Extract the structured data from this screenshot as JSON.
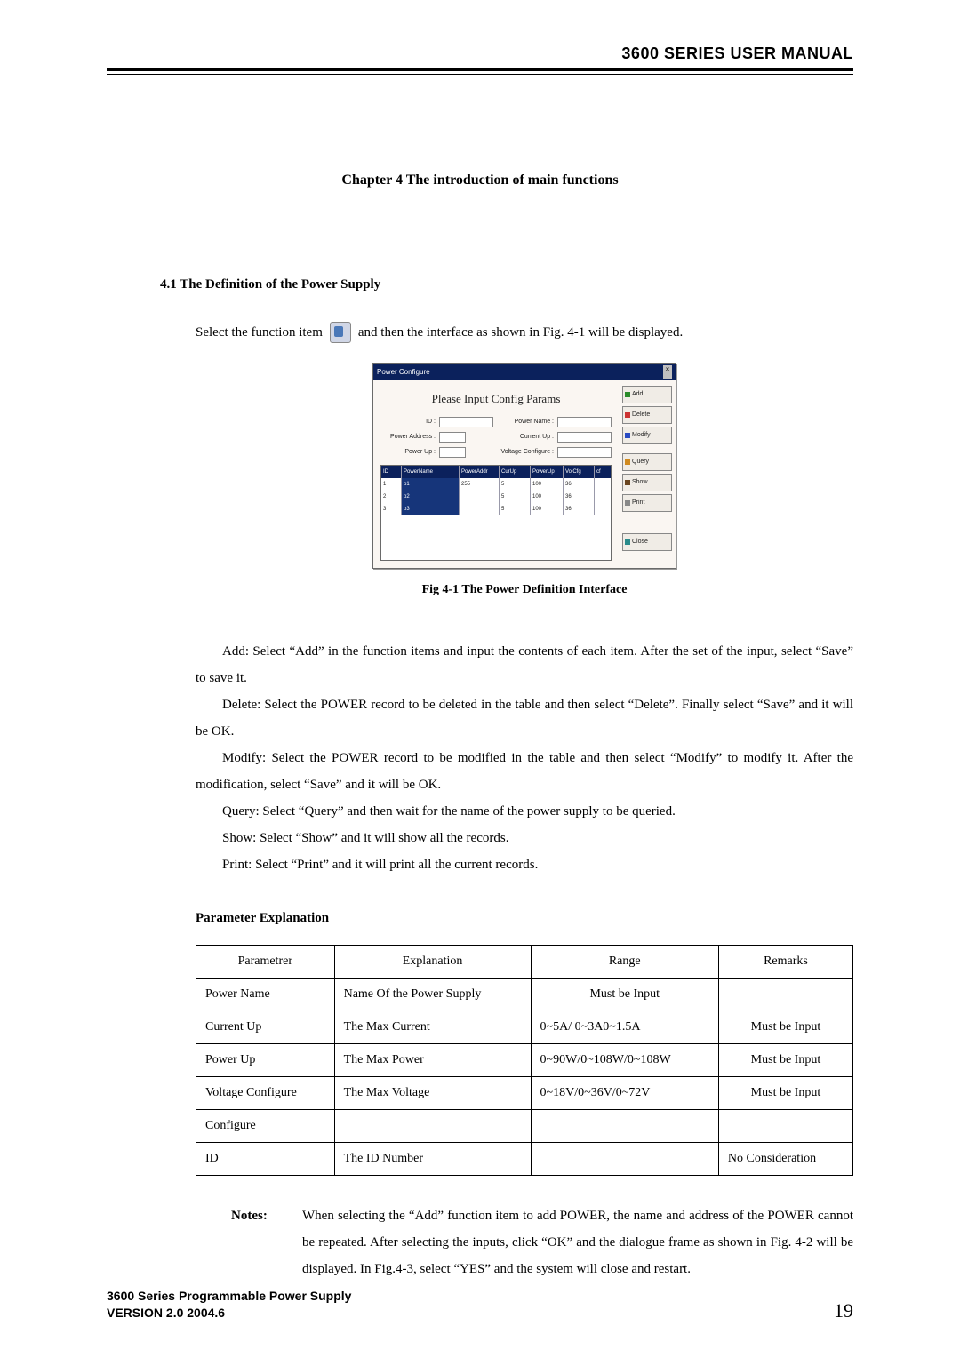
{
  "header": {
    "title": "3600 SERIES USER MANUAL"
  },
  "chapter": "Chapter 4    The introduction of main functions",
  "section": "4.1 The Definition of the Power Supply",
  "select_line": {
    "before": "Select the function item",
    "after": "and then the interface as shown in Fig. 4-1 will be displayed."
  },
  "dialog": {
    "titlebar": "Power Configure",
    "heading": "Please Input Config Params",
    "labels": {
      "id": "ID :",
      "power_name": "Power Name :",
      "power_address": "Power Address :",
      "current_up": "Current Up :",
      "power_up": "Power Up :",
      "voltage_configure": "Voltage Configure :"
    },
    "columns": [
      "ID",
      "PowerName",
      "PowerAddr",
      "CurUp",
      "PowerUp",
      "VolCfg",
      "cf"
    ],
    "rows": [
      {
        "id": "1",
        "name": "p1",
        "pa": "255",
        "cu": "5",
        "pu": "100",
        "vc": "36",
        "cf": ""
      },
      {
        "id": "2",
        "name": "p2",
        "pa": "",
        "cu": "5",
        "pu": "100",
        "vc": "36",
        "cf": ""
      },
      {
        "id": "3",
        "name": "p3",
        "pa": "",
        "cu": "5",
        "pu": "100",
        "vc": "36",
        "cf": ""
      }
    ],
    "buttons": {
      "add": "Add",
      "delete": "Delete",
      "modify": "Modify",
      "query": "Query",
      "show": "Show",
      "print": "Print",
      "close": "Close"
    }
  },
  "fig_caption": "Fig 4-1 The Power Definition Interface",
  "paragraphs": {
    "add": "Add:  Select “Add” in the function items and input the contents of each item. After the set  of the input, select “Save” to save it.",
    "delete": "Delete: Select the POWER record to be deleted in the table and then select “Delete”. Finally select “Save” and it will be OK.",
    "modify": "Modify: Select the POWER record to be modified in the table and then select “Modify” to modify it. After the modification, select “Save” and it will be OK.",
    "query": "Query:  Select “Query” and then wait for the name of the power supply to be queried.",
    "show": "Show:  Select “Show” and it will show all the records.",
    "print": "Print:   Select “Print” and it will print all the current records."
  },
  "param_heading": "Parameter Explanation",
  "param_table": {
    "headers": [
      "Parametrer",
      "Explanation",
      "Range",
      "Remarks"
    ],
    "rows": [
      [
        "Power Name",
        "Name Of the Power Supply",
        "Must be Input",
        ""
      ],
      [
        "Current Up",
        "The Max Current",
        "0~5A/ 0~3A0~1.5A",
        "Must be Input"
      ],
      [
        "Power Up",
        "The Max Power",
        "0~90W/0~108W/0~108W",
        "Must be Input"
      ],
      [
        "Voltage Configure",
        "The Max Voltage",
        "0~18V/0~36V/0~72V",
        "Must be Input"
      ],
      [
        "Configure",
        "",
        "",
        ""
      ],
      [
        "ID",
        "The ID Number",
        "",
        "No Consideration"
      ]
    ]
  },
  "notes": {
    "label": "Notes:",
    "text": "When selecting the “Add” function item to add POWER, the name and address of the POWER cannot be repeated. After selecting the inputs, click “OK” and the dialogue frame as shown in Fig. 4-2 will be displayed. In Fig.4-3, select “YES” and the system will close and restart."
  },
  "footer": {
    "line1": "3600 Series Programmable Power Supply",
    "line2": "VERSION 2.0  2004.6",
    "page": "19"
  }
}
